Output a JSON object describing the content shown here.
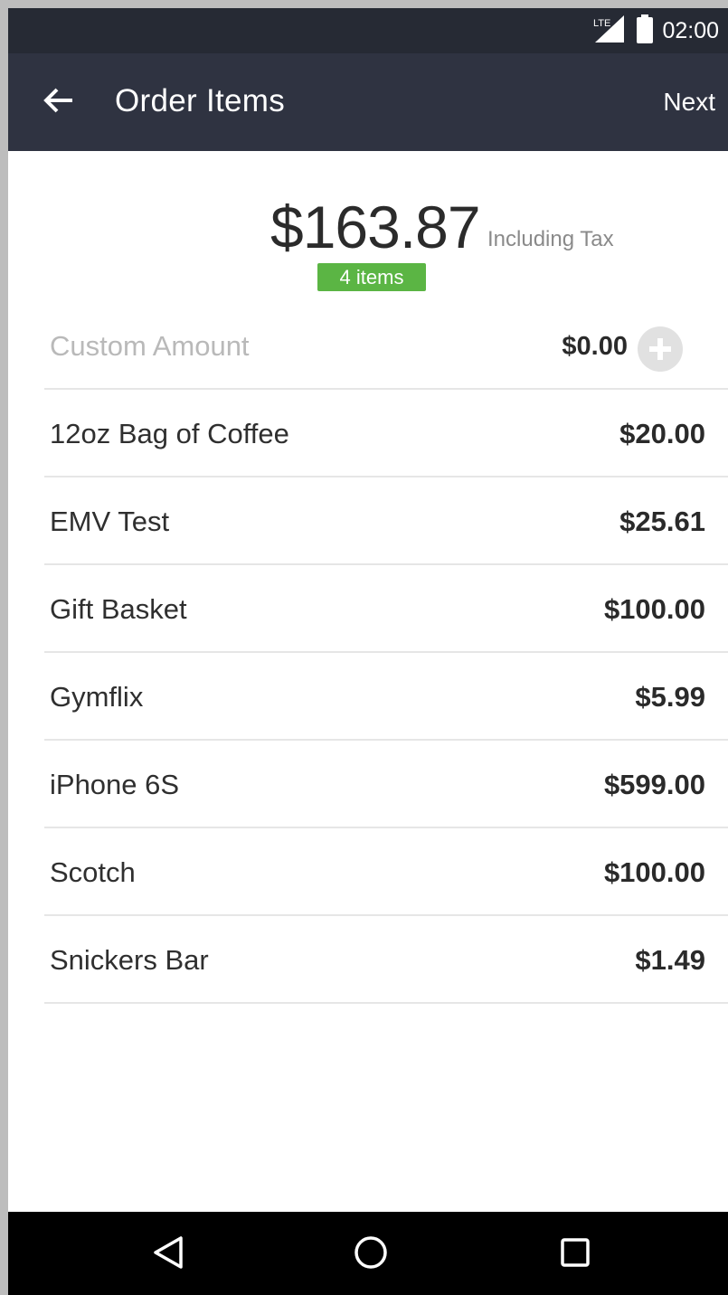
{
  "status_bar": {
    "network": "LTE",
    "time": "02:00"
  },
  "app_bar": {
    "title": "Order Items",
    "next_label": "Next"
  },
  "summary": {
    "total": "$163.87",
    "tax_note": "Including Tax",
    "items_badge": "4 items"
  },
  "custom_amount": {
    "label": "Custom Amount",
    "price": "$0.00"
  },
  "items": [
    {
      "name": "12oz Bag of Coffee",
      "price": "$20.00"
    },
    {
      "name": "EMV Test",
      "price": "$25.61"
    },
    {
      "name": "Gift Basket",
      "price": "$100.00"
    },
    {
      "name": "Gymflix",
      "price": "$5.99"
    },
    {
      "name": "iPhone 6S",
      "price": "$599.00"
    },
    {
      "name": "Scotch",
      "price": "$100.00"
    },
    {
      "name": "Snickers Bar",
      "price": "$1.49"
    }
  ],
  "icons": {
    "back": "arrow-left-icon",
    "add": "plus-circle-icon",
    "signal": "lte-signal-icon",
    "battery": "battery-icon",
    "nav_back": "triangle-back-icon",
    "nav_home": "circle-home-icon",
    "nav_recents": "square-recents-icon"
  },
  "colors": {
    "status_bar": "#262a34",
    "app_bar": "#2f3341",
    "badge": "#5bb544"
  }
}
